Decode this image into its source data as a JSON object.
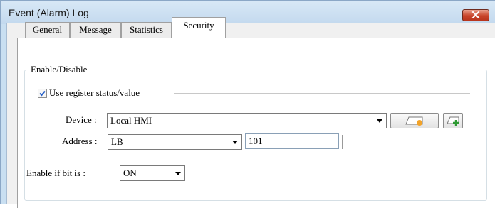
{
  "window": {
    "title": "Event (Alarm) Log",
    "close_icon": "close-x-icon",
    "accent_color": "#c8442a"
  },
  "tabs": [
    {
      "label": "General",
      "active": false
    },
    {
      "label": "Message",
      "active": false
    },
    {
      "label": "Statistics",
      "active": false
    },
    {
      "label": "Security",
      "active": true
    }
  ],
  "enable_group": {
    "title": "Enable/Disable",
    "use_register_label": "Use register status/value",
    "use_register_checked": true,
    "device_label": "Device :",
    "device_value": "Local HMI",
    "device_settings_icon": "device-settings-icon",
    "device_add_icon": "device-add-icon",
    "address_label": "Address :",
    "address_type_value": "LB",
    "address_value": "101",
    "enable_if_label": "Enable if bit is :",
    "enable_if_value": "ON"
  }
}
